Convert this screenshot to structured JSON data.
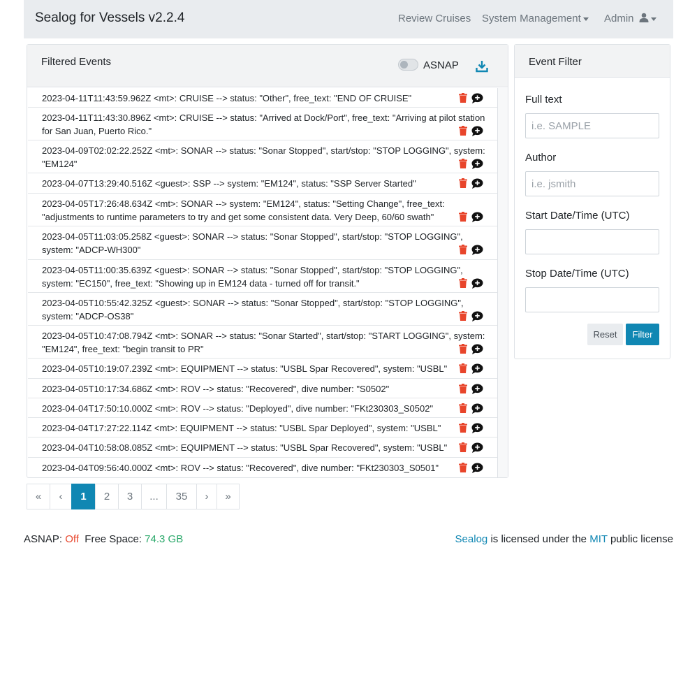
{
  "app": {
    "title": "Sealog for Vessels v2.2.4"
  },
  "nav": {
    "review_cruises": "Review Cruises",
    "system_management": "System Management",
    "admin": "Admin"
  },
  "events_panel": {
    "title": "Filtered Events",
    "asnap_label": "ASNAP",
    "asnap_enabled": false
  },
  "events": [
    {
      "text": "2023-04-11T11:43:59.962Z <mt>: CRUISE --> status: \"Other\", free_text: \"END OF CRUISE\""
    },
    {
      "text": "2023-04-11T11:43:30.896Z <mt>: CRUISE --> status: \"Arrived at Dock/Port\", free_text: \"Arriving at pilot station for San Juan, Puerto Rico.\""
    },
    {
      "text": "2023-04-09T02:02:22.252Z <mt>: SONAR --> status: \"Sonar Stopped\", start/stop: \"STOP LOGGING\", system: \"EM124\""
    },
    {
      "text": "2023-04-07T13:29:40.516Z <guest>: SSP --> system: \"EM124\", status: \"SSP Server Started\""
    },
    {
      "text": "2023-04-05T17:26:48.634Z <mt>: SONAR --> system: \"EM124\", status: \"Setting Change\", free_text: \"adjustments to runtime parameters to try and get some consistent data. Very Deep, 60/60 swath\""
    },
    {
      "text": "2023-04-05T11:03:05.258Z <guest>: SONAR --> status: \"Sonar Stopped\", start/stop: \"STOP LOGGING\", system: \"ADCP-WH300\""
    },
    {
      "text": "2023-04-05T11:00:35.639Z <guest>: SONAR --> status: \"Sonar Stopped\", start/stop: \"STOP LOGGING\", system: \"EC150\", free_text: \"Showing up in EM124 data - turned off for transit.\""
    },
    {
      "text": "2023-04-05T10:55:42.325Z <guest>: SONAR --> status: \"Sonar Stopped\", start/stop: \"STOP LOGGING\", system: \"ADCP-OS38\""
    },
    {
      "text": "2023-04-05T10:47:08.794Z <mt>: SONAR --> status: \"Sonar Started\", start/stop: \"START LOGGING\", system: \"EM124\", free_text: \"begin transit to PR\""
    },
    {
      "text": "2023-04-05T10:19:07.239Z <mt>: EQUIPMENT --> status: \"USBL Spar Recovered\", system: \"USBL\""
    },
    {
      "text": "2023-04-05T10:17:34.686Z <mt>: ROV --> status: \"Recovered\", dive number: \"S0502\""
    },
    {
      "text": "2023-04-04T17:50:10.000Z <mt>: ROV --> status: \"Deployed\", dive number: \"FKt230303_S0502\""
    },
    {
      "text": "2023-04-04T17:27:22.114Z <mt>: EQUIPMENT --> status: \"USBL Spar Deployed\", system: \"USBL\""
    },
    {
      "text": "2023-04-04T10:58:08.085Z <mt>: EQUIPMENT --> status: \"USBL Spar Recovered\", system: \"USBL\""
    },
    {
      "text": "2023-04-04T09:56:40.000Z <mt>: ROV --> status: \"Recovered\", dive number: \"FKt230303_S0501\""
    }
  ],
  "pagination": {
    "first": "«",
    "prev": "‹",
    "pages": [
      "1",
      "2",
      "3",
      "...",
      "35"
    ],
    "current": "1",
    "next": "›",
    "last": "»"
  },
  "filter": {
    "title": "Event Filter",
    "fulltext_label": "Full text",
    "fulltext_placeholder": "i.e. SAMPLE",
    "fulltext_value": "",
    "author_label": "Author",
    "author_placeholder": "i.e. jsmith",
    "author_value": "",
    "start_label": "Start Date/Time (UTC)",
    "start_value": "",
    "stop_label": "Stop Date/Time (UTC)",
    "stop_value": "",
    "reset_label": "Reset",
    "filter_label": "Filter"
  },
  "footer": {
    "asnap_label": "ASNAP:",
    "asnap_status": "Off",
    "free_space_label": "Free Space:",
    "free_space_value": "74.3 GB",
    "sealog_link": "Sealog",
    "license_mid": "is licensed under the",
    "mit_link": "MIT",
    "license_end": "public license"
  },
  "colors": {
    "accent": "#1087b3",
    "trash": "#e8452b",
    "off": "#e8452b",
    "free_space": "#2aa86a",
    "navbar": "#e9ecef"
  },
  "icons": {
    "admin": "user-icon",
    "download": "download-icon",
    "delete": "trash-icon",
    "comment": "comment-add-icon"
  }
}
